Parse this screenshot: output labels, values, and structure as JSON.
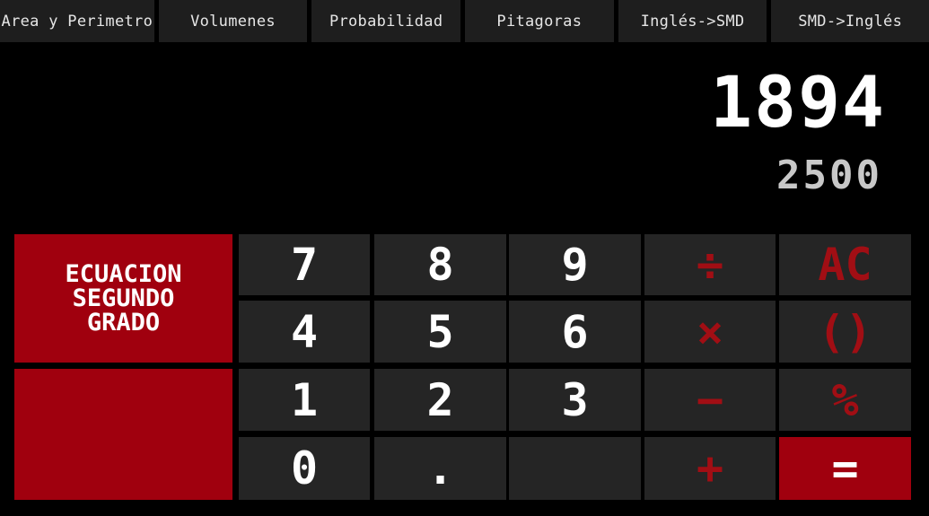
{
  "tabs": [
    "Area y Perimetro",
    "Volumenes",
    "Probabilidad",
    "Pitagoras",
    "Inglés->SMD",
    "SMD->Inglés"
  ],
  "display": {
    "main": "1894",
    "secondary": "2500"
  },
  "side": {
    "equation_label": "ECUACION\nSEGUNDO\nGRADO"
  },
  "keys": {
    "k7": "7",
    "k8": "8",
    "k9": "9",
    "div": "÷",
    "ac": "AC",
    "k4": "4",
    "k5": "5",
    "k6": "6",
    "mul": "×",
    "paren": "()",
    "k1": "1",
    "k2": "2",
    "k3": "3",
    "sub": "−",
    "pct": "%",
    "k0": "0",
    "dot": ".",
    "add": "+",
    "eq": "="
  },
  "colors": {
    "accent": "#a0000e",
    "key_bg": "#252525",
    "operator_text": "#a10e14"
  }
}
